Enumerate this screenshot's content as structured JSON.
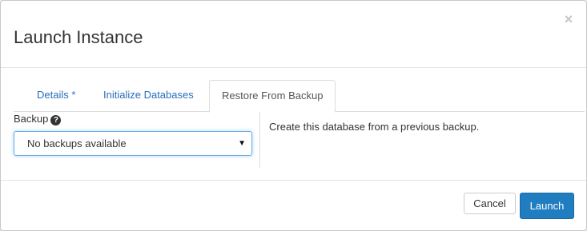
{
  "dialog": {
    "title": "Launch Instance",
    "close_symbol": "×"
  },
  "tabs": [
    {
      "label": "Details *",
      "active": false
    },
    {
      "label": "Initialize Databases",
      "active": false
    },
    {
      "label": "Restore From Backup",
      "active": true
    }
  ],
  "form": {
    "backup_label": "Backup",
    "help_icon": "?",
    "backup_select": {
      "selected": "No backups available",
      "arrow": "▼"
    },
    "help_text": "Create this database from a previous backup."
  },
  "footer": {
    "cancel_label": "Cancel",
    "launch_label": "Launch"
  },
  "colors": {
    "link": "#2a6ebb",
    "primary": "#1f7dc0",
    "focus_border": "#66afe9"
  }
}
